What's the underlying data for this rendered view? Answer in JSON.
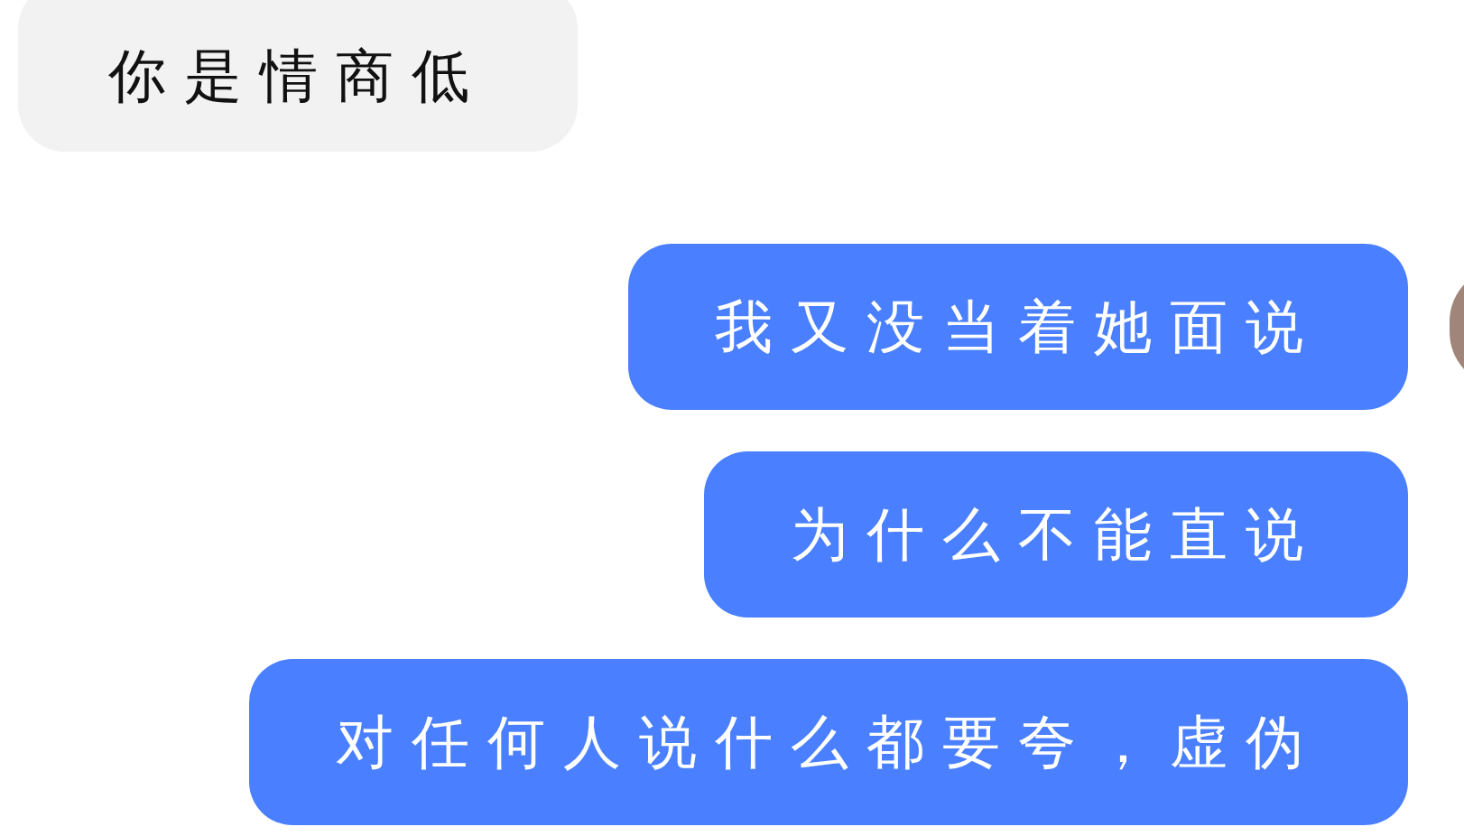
{
  "messages": [
    {
      "kind": "incoming",
      "text": "你是情商低",
      "avatar": false
    },
    {
      "kind": "outgoing",
      "text": "我又没当着她面说",
      "avatar": true
    },
    {
      "kind": "outgoing",
      "text": "为什么不能直说",
      "avatar": false
    },
    {
      "kind": "outgoing",
      "text": "对任何人说什么都要夸，虚伪",
      "avatar": false
    }
  ]
}
